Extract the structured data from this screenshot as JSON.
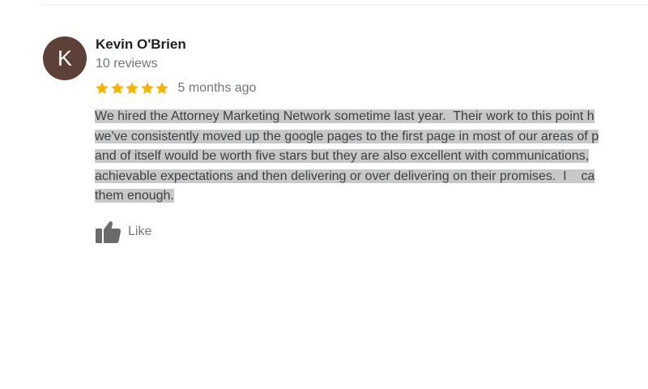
{
  "review": {
    "author": {
      "initial": "K",
      "name": "Kevin O'Brien",
      "review_count": "10 reviews",
      "avatar_color": "#5d4037"
    },
    "rating": {
      "stars": 5,
      "max_stars": 5,
      "star_color": "#f4b400",
      "date": "5 months ago"
    },
    "text_lines": [
      "We hired the Attorney Marketing Network sometime last year.  Their work to this point h",
      "we've consistently moved up the google pages to the first page in most of our areas of p",
      "and of itself would be worth five stars but they are also excellent with communications,",
      "achievable expectations and then delivering or over delivering on their promises.  I    ca",
      "them enough."
    ],
    "like": {
      "icon": "thumbs-up-icon",
      "label": "Like"
    }
  }
}
